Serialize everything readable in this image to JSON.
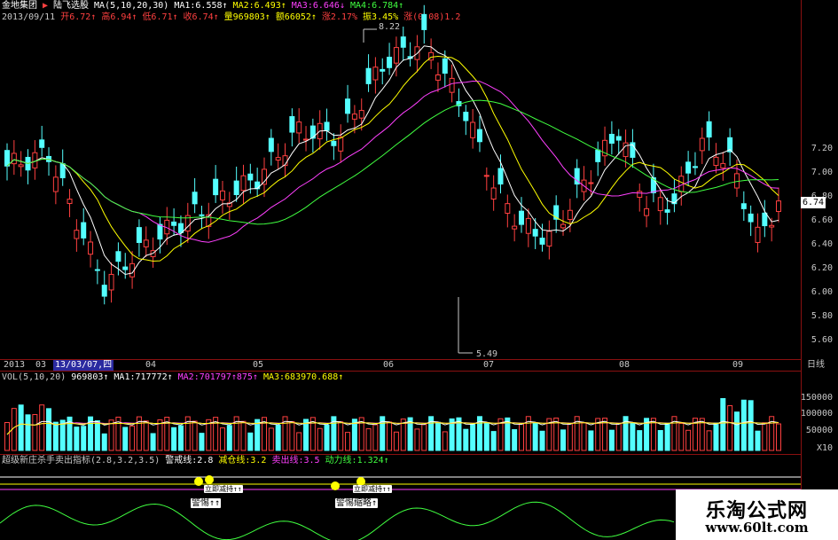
{
  "header": {
    "row1": {
      "company": "金地集团",
      "indicator": "陆飞选股",
      "ma_params": "MA(5,10,20,30)",
      "ma1": "MA1:6.558↑",
      "ma2": "MA2:6.493↑",
      "ma3": "MA3:6.646↓",
      "ma4": "MA4:6.784↑"
    },
    "row2": {
      "date": "2013/09/11",
      "open": "开6.72↑",
      "high": "高6.94↑",
      "low": "低6.71↑",
      "close": "收6.74↑",
      "volume": "量969803↑",
      "amount": "额66052↑",
      "change": "涨2.17%",
      "amplitude": "振3.45%",
      "delta": "涨(0.08)1.2"
    }
  },
  "price_axis": [
    "7.20",
    "7.00",
    "6.80",
    "6.60",
    "6.40",
    "6.20",
    "6.00",
    "5.80",
    "5.60"
  ],
  "current_price": "6.74",
  "annotations": {
    "high": "8.22",
    "low": "5.49"
  },
  "time_axis": {
    "start": "2013",
    "m03": "03",
    "date_chip": "13/03/07,四",
    "months": [
      "04",
      "05",
      "06",
      "07",
      "08",
      "09"
    ],
    "period": "日线"
  },
  "volume_panel": {
    "params": "VOL(5,10,20)",
    "vol": "969803↑",
    "ma1": "MA1:717772↑",
    "ma2": "MA2:701797↑875↑",
    "ma3": "MA3:683970.688↑",
    "axis": [
      "150000",
      "100000",
      "50000"
    ],
    "unit": "X10"
  },
  "indicator_panel": {
    "name": "超级新庄杀手卖出指标",
    "params": "(2.8,3.2,3.5)",
    "warn": "警戒线:2.8",
    "reduce": "减仓线:3.2",
    "sell": "卖出线:3.5",
    "power": "动力线:1.324↑",
    "labels": [
      "警惕↑↑",
      "警惕",
      "警惕↑↑",
      "警惕缩略↑"
    ],
    "small_labels": [
      "立即减持↑↑",
      "立即减持↑↑"
    ]
  },
  "watermark": {
    "title": "乐淘公式网",
    "url": "www.60lt.com"
  },
  "colors": {
    "up": "#ff4040",
    "down": "#54ffff",
    "ma1": "#ffffff",
    "ma2": "#ffff00",
    "ma3": "#ff40ff",
    "ma4": "#40ff40",
    "red_sep": "#8a1010"
  }
}
